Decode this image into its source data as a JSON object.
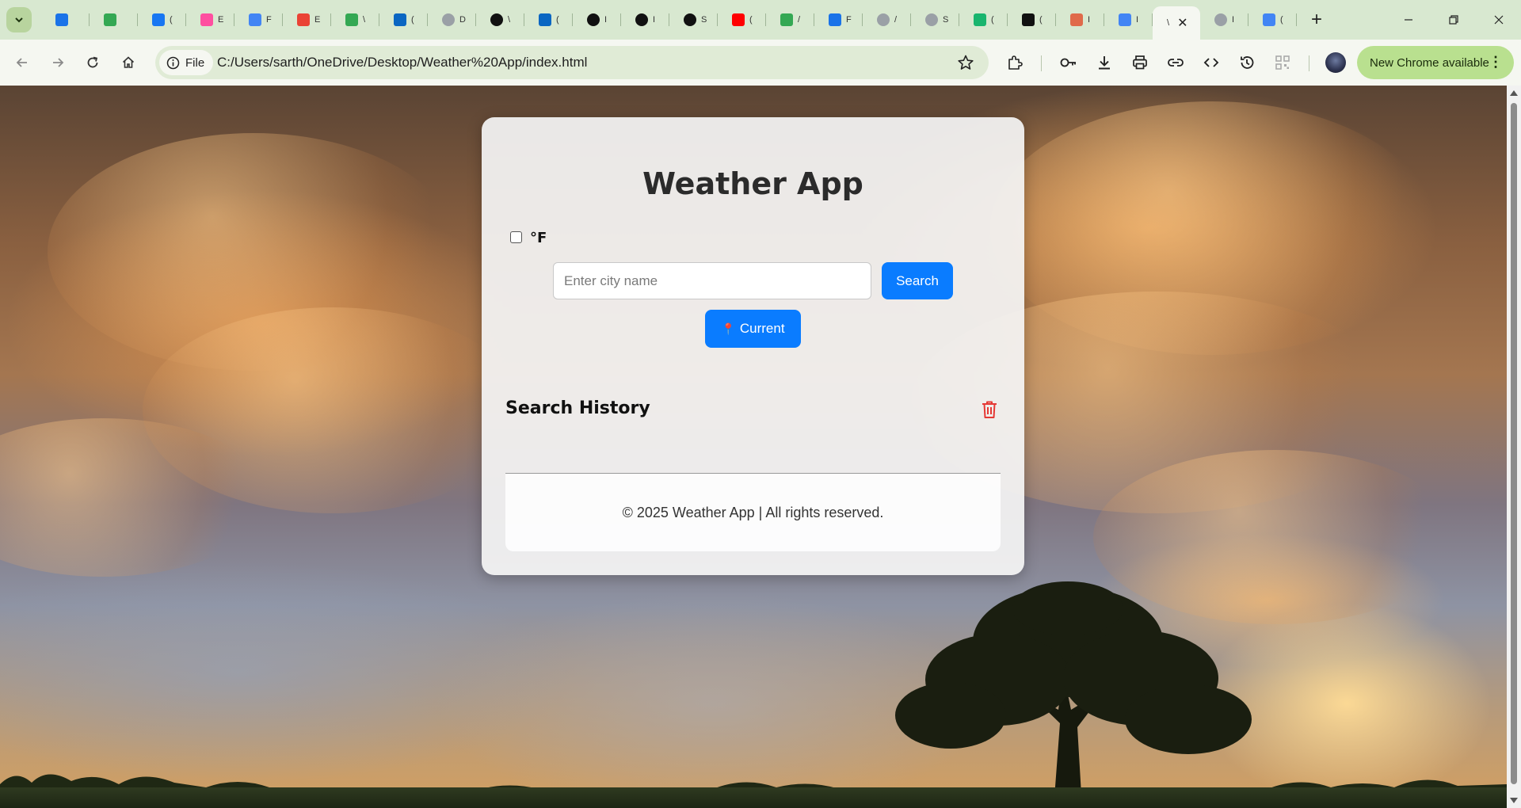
{
  "browser": {
    "tabs": [
      {
        "icon": "gear-icon",
        "text": "",
        "color": "#1a73e8"
      },
      {
        "icon": "google-drive-icon",
        "text": "",
        "color": "#34a853"
      },
      {
        "icon": "facebook-icon",
        "text": "(",
        "color": "#1877f2"
      },
      {
        "icon": "cube-icon",
        "text": "E",
        "color": "#ff4fa0"
      },
      {
        "icon": "cloud-icon",
        "text": "F",
        "color": "#4285f4"
      },
      {
        "icon": "gmail-icon",
        "text": "E",
        "color": "#ea4335"
      },
      {
        "icon": "google-drive-icon",
        "text": "\\",
        "color": "#34a853"
      },
      {
        "icon": "linkedin-icon",
        "text": "(",
        "color": "#0a66c2"
      },
      {
        "icon": "globe-icon",
        "text": "D",
        "color": "#9aa0a6"
      },
      {
        "icon": "threads-icon",
        "text": "\\",
        "color": "#111111"
      },
      {
        "icon": "linkedin-icon",
        "text": "(",
        "color": "#0a66c2"
      },
      {
        "icon": "github-icon",
        "text": "I",
        "color": "#111111"
      },
      {
        "icon": "triangle-icon",
        "text": "I",
        "color": "#111111"
      },
      {
        "icon": "github-icon",
        "text": "S",
        "color": "#111111"
      },
      {
        "icon": "youtube-icon",
        "text": "(",
        "color": "#ff0000"
      },
      {
        "icon": "google-drive-icon",
        "text": "/",
        "color": "#34a853"
      },
      {
        "icon": "flag-icon",
        "text": "F",
        "color": "#1a73e8"
      },
      {
        "icon": "globe-icon",
        "text": "/",
        "color": "#9aa0a6"
      },
      {
        "icon": "globe-icon",
        "text": "S",
        "color": "#9aa0a6"
      },
      {
        "icon": "infinity-icon",
        "text": "(",
        "color": "#19b56e"
      },
      {
        "icon": "amazon-icon",
        "text": "(",
        "color": "#111111"
      },
      {
        "icon": "mushroom-icon",
        "text": "I",
        "color": "#e06a4a"
      },
      {
        "icon": "google-icon",
        "text": "I",
        "color": "#4285f4"
      },
      {
        "icon": "tab-active",
        "text": "\\",
        "color": "#555555"
      },
      {
        "icon": "globe-icon",
        "text": "I",
        "color": "#9aa0a6"
      },
      {
        "icon": "google-icon",
        "text": "(",
        "color": "#4285f4"
      }
    ],
    "active_tab_index": 23,
    "address": {
      "chip_label": "File",
      "url": "C:/Users/sarth/OneDrive/Desktop/Weather%20App/index.html"
    },
    "update_label": "New Chrome available"
  },
  "app": {
    "title": "Weather App",
    "unit_label": "°F",
    "unit_checked": false,
    "search": {
      "placeholder": "Enter city name",
      "value": "",
      "button_label": "Search"
    },
    "current_button_label": "Current",
    "history_title": "Search History",
    "history_items": [],
    "footer_text": "© 2025 Weather App | All rights reserved."
  },
  "colors": {
    "accent": "#0a7cff",
    "trash": "#e53935",
    "chrome_frame": "#d8e8d0",
    "chrome_toolbar": "#f5f7f1",
    "update_pill": "#b9e08f"
  }
}
